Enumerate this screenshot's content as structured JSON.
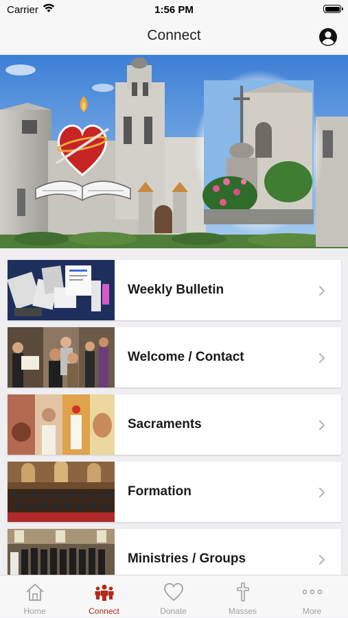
{
  "status_bar": {
    "carrier": "Carrier",
    "time": "1:56 PM"
  },
  "nav": {
    "title": "Connect"
  },
  "list": {
    "items": [
      {
        "label": "Weekly Bulletin"
      },
      {
        "label": "Welcome / Contact"
      },
      {
        "label": "Sacraments"
      },
      {
        "label": "Formation"
      },
      {
        "label": "Ministries / Groups"
      }
    ]
  },
  "tabs": [
    {
      "label": "Home",
      "icon": "house-icon",
      "active": false
    },
    {
      "label": "Connect",
      "icon": "people-icon",
      "active": true
    },
    {
      "label": "Donate",
      "icon": "heart-icon",
      "active": false
    },
    {
      "label": "Masses",
      "icon": "cross-icon",
      "active": false
    },
    {
      "label": "More",
      "icon": "ellipsis-icon",
      "active": false
    }
  ],
  "colors": {
    "accent": "#b22a1a",
    "inactive": "#a0a0a0",
    "background": "#efeff2"
  }
}
